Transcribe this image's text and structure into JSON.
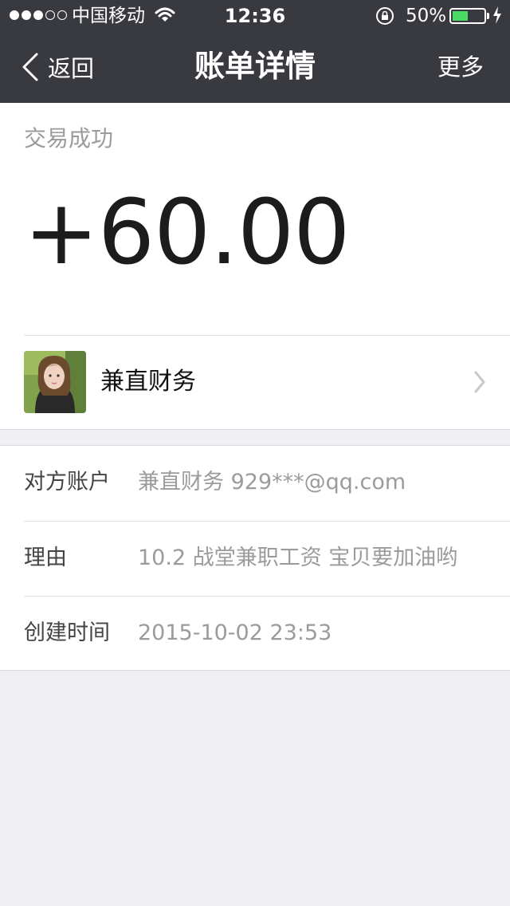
{
  "status_bar": {
    "carrier": "中国移动",
    "time": "12:36",
    "battery_percent": "50%",
    "battery_level": 0.5,
    "signal_bars_filled": 3,
    "signal_bars_total": 5
  },
  "nav": {
    "back_label": "返回",
    "title": "账单详情",
    "more_label": "更多"
  },
  "transaction": {
    "status": "交易成功",
    "amount": "+60.00",
    "payer_name": "兼直财务"
  },
  "details": [
    {
      "label": "对方账户",
      "value": "兼直财务 929***@qq.com"
    },
    {
      "label": "理由",
      "value": "10.2 战堂兼职工资 宝贝要加油哟"
    },
    {
      "label": "创建时间",
      "value": "2015-10-02 23:53"
    }
  ],
  "colors": {
    "header_bg": "#393a3f",
    "page_bg": "#efeff4",
    "battery_green": "#4cd964"
  }
}
